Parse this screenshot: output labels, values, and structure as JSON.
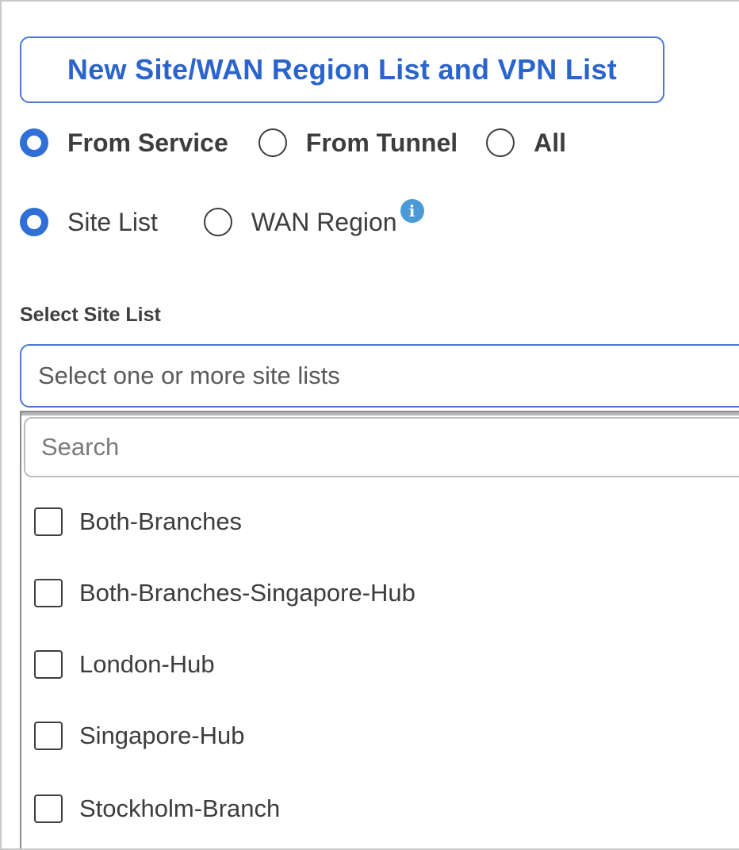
{
  "header": {
    "new_button_label": "New Site/WAN Region List and VPN List"
  },
  "source_filter": {
    "options": [
      {
        "label": "From Service",
        "selected": true
      },
      {
        "label": "From Tunnel",
        "selected": false
      },
      {
        "label": "All",
        "selected": false
      }
    ]
  },
  "scope_filter": {
    "options": [
      {
        "label": "Site List",
        "selected": true
      },
      {
        "label": "WAN Region",
        "selected": false
      }
    ],
    "info_icon": "i"
  },
  "site_list_select": {
    "label": "Select Site List",
    "placeholder": "Select one or more site lists",
    "search_placeholder": "Search",
    "items": [
      {
        "label": "Both-Branches",
        "checked": false
      },
      {
        "label": "Both-Branches-Singapore-Hub",
        "checked": false
      },
      {
        "label": "London-Hub",
        "checked": false
      },
      {
        "label": "Singapore-Hub",
        "checked": false
      },
      {
        "label": "Stockholm-Branch",
        "checked": false
      }
    ]
  },
  "colors": {
    "accent": "#2f6fd6",
    "button_text": "#2b64cc",
    "info_icon": "#4a9ad8"
  }
}
